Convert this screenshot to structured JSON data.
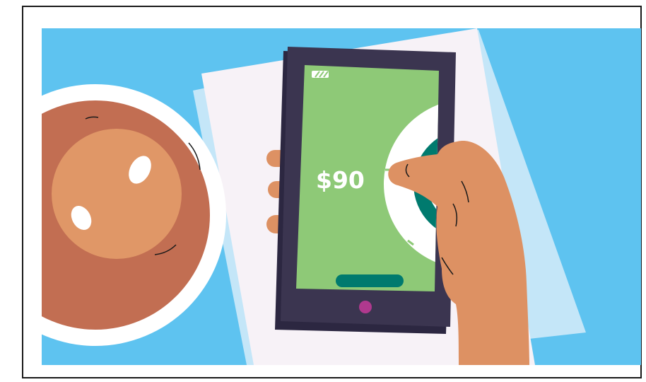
{
  "illustration": {
    "subject": "hand-holding-phone-payment",
    "phone_screen": {
      "amount_label": "$90",
      "battery_icon": "battery-icon",
      "action_bar_icon": "pill-button-icon",
      "home_button_icon": "home-button-icon"
    },
    "colors": {
      "background": "#5ec3f0",
      "paper": "#f7f2f7",
      "paper_shadow": "#c4e6f8",
      "phone_body": "#3b3550",
      "phone_screen": "#8ec977",
      "action_bar": "#007a6e",
      "home_button": "#b0398e",
      "hand": "#dd9163",
      "coffee_rim": "#ffffff",
      "coffee_dark": "#c26e52",
      "coffee_light": "#e09767",
      "card_ring": "#007a6e"
    }
  }
}
